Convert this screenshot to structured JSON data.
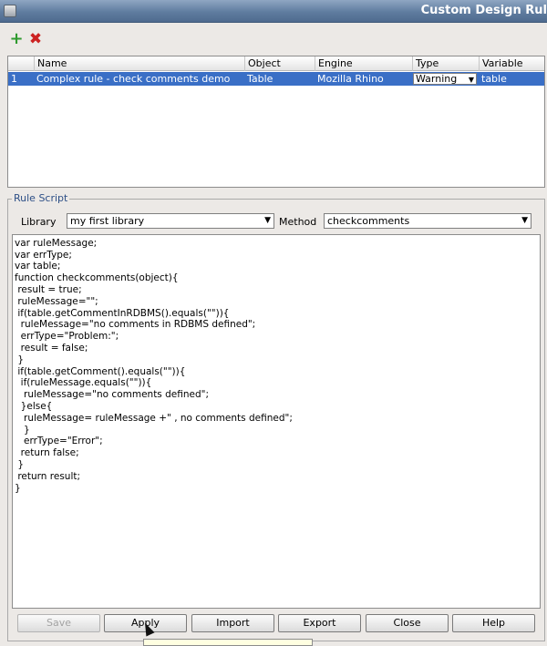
{
  "window": {
    "title": "Custom Design Rul"
  },
  "toolbar": {
    "add_icon": "+",
    "delete_icon": "✖"
  },
  "table": {
    "columns": [
      "Name",
      "Object",
      "Engine",
      "Type",
      "Variable"
    ],
    "rows": [
      {
        "index": "1",
        "name": "Complex rule - check comments demo",
        "object": "Table",
        "engine": "Mozilla Rhino",
        "type": "Warning",
        "variable": "table"
      }
    ],
    "selection_color": "#3a6fc6"
  },
  "rule_script": {
    "legend": "Rule Script",
    "library_label": "Library",
    "library_value": "my first library",
    "method_label": "Method",
    "method_value": "checkcomments",
    "code": [
      "var ruleMessage;",
      "var errType;",
      "var table;",
      "function checkcomments(object){",
      " result = true;",
      " ruleMessage=\"\";",
      " if(table.getCommentInRDBMS().equals(\"\")){",
      "  ruleMessage=\"no comments in RDBMS defined\";",
      "  errType=\"Problem:\";",
      "  result = false;",
      " }",
      " if(table.getComment().equals(\"\")){",
      "  if(ruleMessage.equals(\"\")){",
      "   ruleMessage=\"no comments defined\";",
      "  }else{",
      "   ruleMessage= ruleMessage +\" , no comments defined\";",
      "   }",
      "   errType=\"Error\";",
      "  return false;",
      " }",
      " return result;",
      "}"
    ]
  },
  "buttons": {
    "save": "Save",
    "apply": "Apply",
    "import": "Import",
    "export": "Export",
    "close": "Close",
    "help": "Help"
  }
}
